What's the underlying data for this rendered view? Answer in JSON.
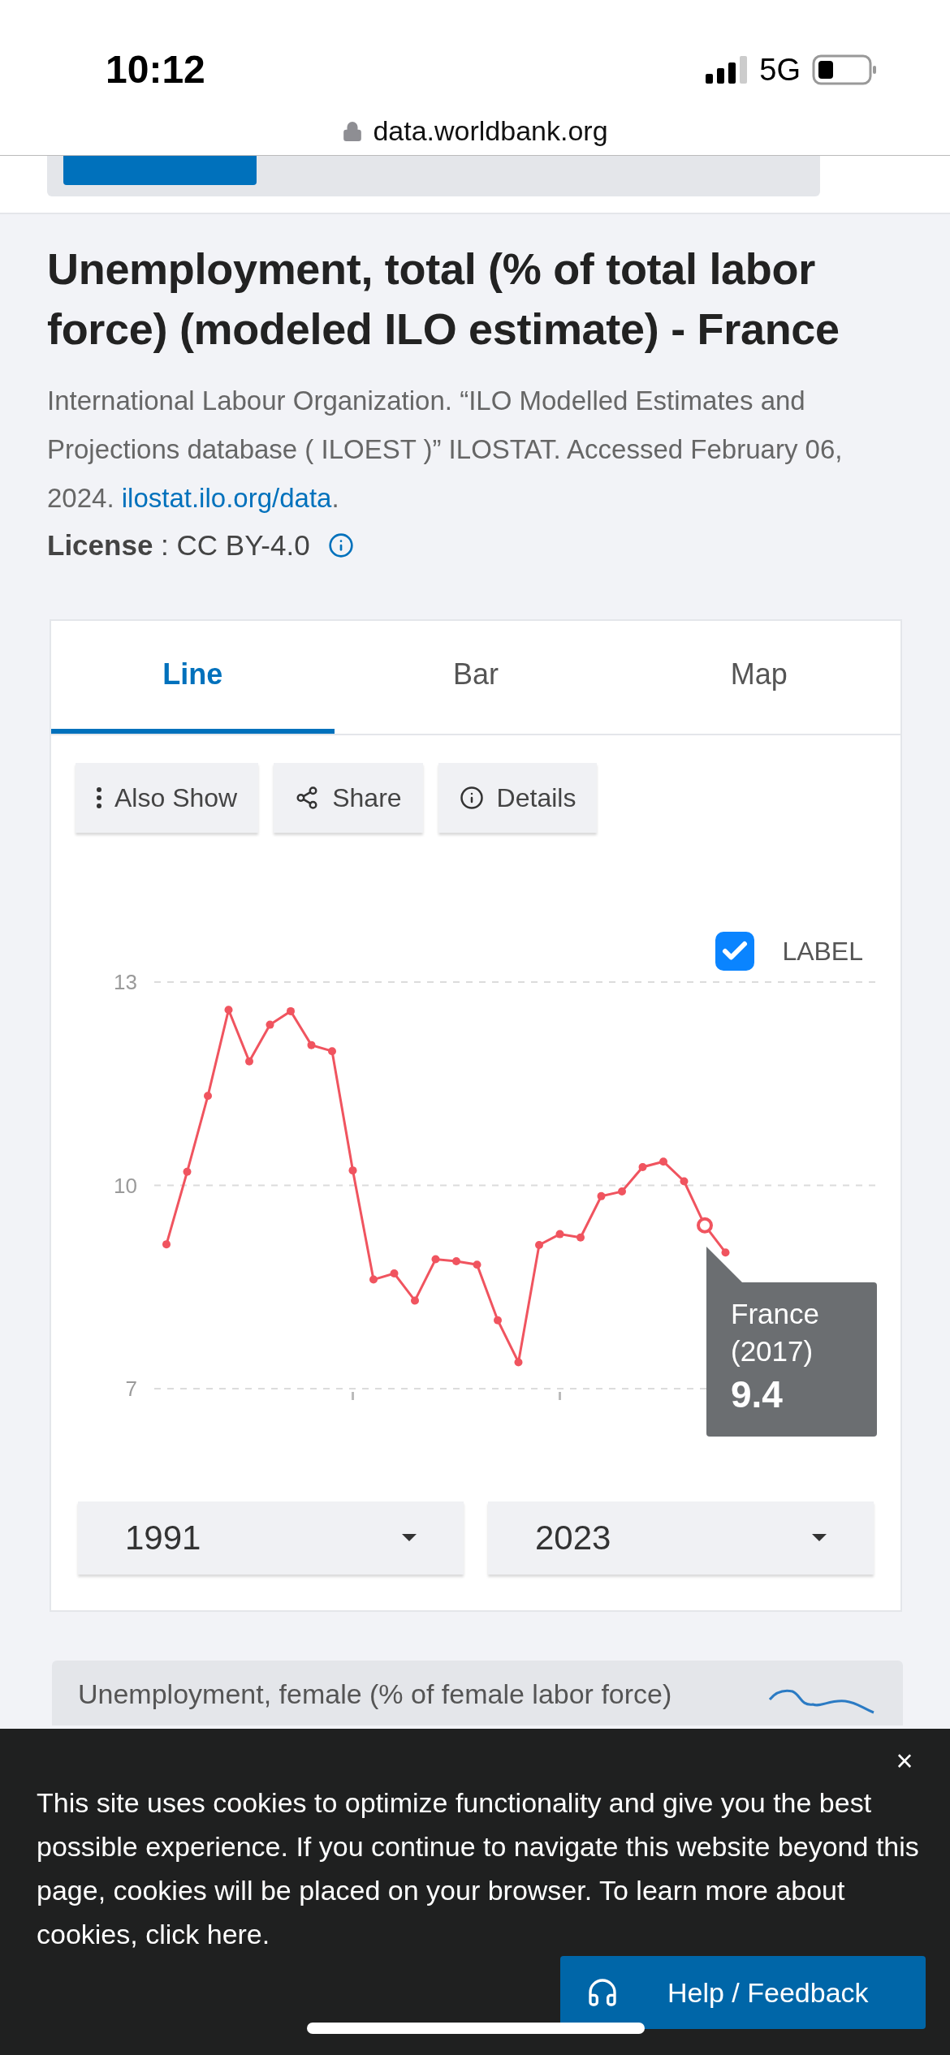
{
  "status_bar": {
    "time": "10:12",
    "network": "5G"
  },
  "browser": {
    "url": "data.worldbank.org"
  },
  "page": {
    "title": "Unemployment, total (% of total labor force) (modeled ILO estimate) - France",
    "citation": {
      "text": "International Labour Organization. “ILO Modelled Estimates and Projections database ( ILOEST )” ILOSTAT. Accessed February 06, 2024. ",
      "link": "ilostat.ilo.org/data",
      "after": "."
    },
    "license": "**License** : CC BY-4.0"
  },
  "chart_card": {
    "tabs": [
      {
        "label": "Line",
        "selected": true
      },
      {
        "label": "Bar",
        "selected": false
      },
      {
        "label": "Map",
        "selected": false
      }
    ],
    "actions": [
      {
        "label": "Also Show",
        "kind": "more"
      },
      {
        "label": "Share",
        "kind": "share"
      },
      {
        "label": "Details",
        "kind": "info"
      }
    ],
    "label_toggle": {
      "label": "LABEL",
      "checked": true
    },
    "chart_data": {
      "type": "line",
      "series": [
        {
          "name": "France",
          "color": "#f0545f",
          "marker": "circle",
          "values": [
            9.13,
            10.2,
            11.32,
            12.59,
            11.83,
            12.37,
            12.57,
            12.07,
            11.98,
            10.22,
            8.61,
            8.7,
            8.3,
            8.91,
            8.88,
            8.83,
            8.01,
            7.39,
            9.12,
            9.28,
            9.23,
            9.84,
            9.91,
            10.27,
            10.35,
            10.06,
            9.41,
            9.01,
            null,
            null,
            null,
            null,
            null
          ]
        }
      ],
      "ylim": [
        7,
        13
      ],
      "yticks": [
        {
          "value": 7,
          "label": "7"
        },
        {
          "value": 10,
          "label": "10"
        },
        {
          "value": 13,
          "label": "13"
        }
      ]
    },
    "tooltip": {
      "year": "(2017)",
      "value": "9.4"
    },
    "range": {
      "from": "1991",
      "to": "2023"
    }
  },
  "related": [
    {
      "title": "Unemployment, female (% of female labor force)"
    }
  ],
  "cookie_banner": {
    "text": "This site uses cookies to optimize functionality and give you the best possible experience. If you continue to navigate this website beyond this page, cookies will be placed on your browser. To learn more about cookies, click here.",
    "close": "×"
  },
  "help_button": {
    "label": "Help / Feedback"
  }
}
